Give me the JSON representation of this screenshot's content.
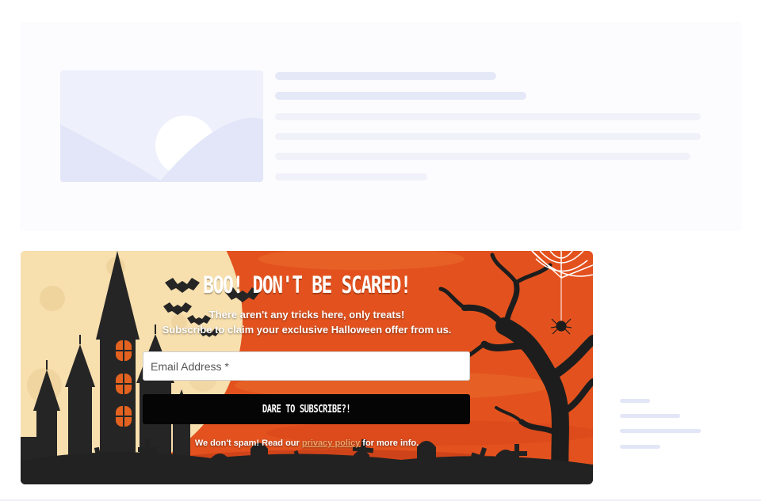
{
  "popup": {
    "headline": "BOO! DON'T BE SCARED!",
    "subtext_line1": "There aren't any tricks here, only treats!",
    "subtext_line2": "Subscribe to claim your exclusive Halloween offer from us.",
    "email_placeholder": "Email Address *",
    "cta_label": "DARE TO SUBSCRIBE?!",
    "disclaimer_prefix": "We don't spam! Read our",
    "disclaimer_link": "privacy policy",
    "disclaimer_suffix": "for more info.",
    "colors": {
      "background": "#e3521e",
      "moon": "#f7dfae",
      "silhouette": "#222222",
      "window": "#e4621f",
      "link": "#f0a36a",
      "button": "#050505"
    }
  },
  "icons": [
    "castle-illustration",
    "bat-icon",
    "spider-icon",
    "spiderweb-icon",
    "tree-illustration",
    "tombstone-icon",
    "cross-icon"
  ]
}
